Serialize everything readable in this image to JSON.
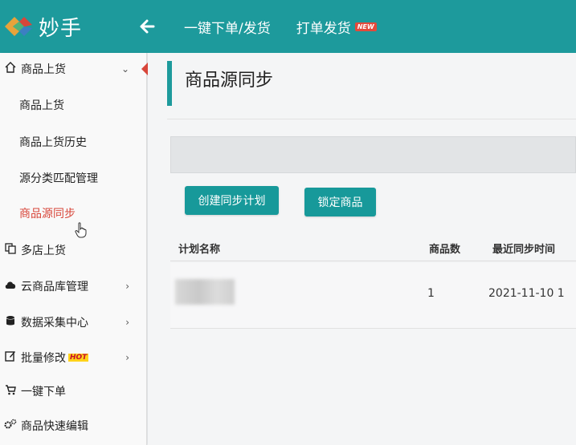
{
  "app": {
    "name": "妙手",
    "accent_color": "#1d9a9c",
    "active_color": "#d8463a"
  },
  "topnav": {
    "back_icon": "arrow-left-icon",
    "items": [
      {
        "label": "一键下单/发货"
      },
      {
        "label": "打单发货",
        "badge": "NEW"
      }
    ]
  },
  "sidebar": {
    "groups": [
      {
        "label": "商品上货",
        "icon": "home-icon",
        "expanded": true
      },
      {
        "label": "多店上货",
        "icon": "copy-icon"
      },
      {
        "label": "云商品库管理",
        "icon": "cloud-icon"
      },
      {
        "label": "数据采集中心",
        "icon": "database-icon"
      },
      {
        "label": "批量修改",
        "icon": "edit-icon",
        "badge": "HOT"
      },
      {
        "label": "一键下单",
        "icon": "cart-icon"
      },
      {
        "label": "商品快速编辑",
        "icon": "gears-icon"
      }
    ],
    "subitems": [
      {
        "label": "商品上货"
      },
      {
        "label": "商品上货历史"
      },
      {
        "label": "源分类匹配管理"
      },
      {
        "label": "商品源同步",
        "active": true
      }
    ]
  },
  "main": {
    "title": "商品源同步",
    "buttons": {
      "create_plan": "创建同步计划",
      "lock_products": "锁定商品"
    },
    "table": {
      "headers": [
        "计划名称",
        "商品数",
        "最近同步时间"
      ],
      "rows": [
        {
          "name": "",
          "count": "1",
          "last_sync": "2021-11-10 1"
        }
      ]
    }
  }
}
